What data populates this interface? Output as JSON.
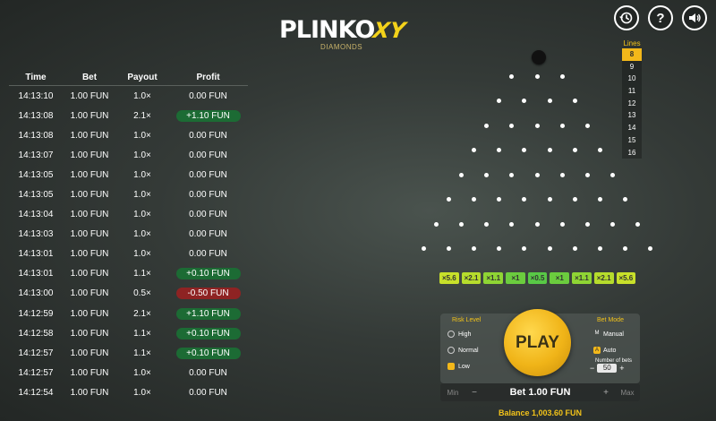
{
  "header": {
    "logo_text": "PLINKO",
    "logo_xy": "XY",
    "logo_sub": "DIAMONDS",
    "icons": [
      "history-icon",
      "help-icon",
      "sound-icon"
    ],
    "help_glyph": "?"
  },
  "history": {
    "columns": [
      "Time",
      "Bet",
      "Payout",
      "Profit"
    ],
    "rows": [
      {
        "time": "14:13:10",
        "bet": "1.00 FUN",
        "payout": "1.0×",
        "profit": "0.00 FUN",
        "type": "none"
      },
      {
        "time": "14:13:08",
        "bet": "1.00 FUN",
        "payout": "2.1×",
        "profit": "+1.10 FUN",
        "type": "win"
      },
      {
        "time": "14:13:08",
        "bet": "1.00 FUN",
        "payout": "1.0×",
        "profit": "0.00 FUN",
        "type": "none"
      },
      {
        "time": "14:13:07",
        "bet": "1.00 FUN",
        "payout": "1.0×",
        "profit": "0.00 FUN",
        "type": "none"
      },
      {
        "time": "14:13:05",
        "bet": "1.00 FUN",
        "payout": "1.0×",
        "profit": "0.00 FUN",
        "type": "none"
      },
      {
        "time": "14:13:05",
        "bet": "1.00 FUN",
        "payout": "1.0×",
        "profit": "0.00 FUN",
        "type": "none"
      },
      {
        "time": "14:13:04",
        "bet": "1.00 FUN",
        "payout": "1.0×",
        "profit": "0.00 FUN",
        "type": "none"
      },
      {
        "time": "14:13:03",
        "bet": "1.00 FUN",
        "payout": "1.0×",
        "profit": "0.00 FUN",
        "type": "none"
      },
      {
        "time": "14:13:01",
        "bet": "1.00 FUN",
        "payout": "1.0×",
        "profit": "0.00 FUN",
        "type": "none"
      },
      {
        "time": "14:13:01",
        "bet": "1.00 FUN",
        "payout": "1.1×",
        "profit": "+0.10 FUN",
        "type": "win"
      },
      {
        "time": "14:13:00",
        "bet": "1.00 FUN",
        "payout": "0.5×",
        "profit": "-0.50 FUN",
        "type": "loss"
      },
      {
        "time": "14:12:59",
        "bet": "1.00 FUN",
        "payout": "2.1×",
        "profit": "+1.10 FUN",
        "type": "win"
      },
      {
        "time": "14:12:58",
        "bet": "1.00 FUN",
        "payout": "1.1×",
        "profit": "+0.10 FUN",
        "type": "win"
      },
      {
        "time": "14:12:57",
        "bet": "1.00 FUN",
        "payout": "1.1×",
        "profit": "+0.10 FUN",
        "type": "win"
      },
      {
        "time": "14:12:57",
        "bet": "1.00 FUN",
        "payout": "1.0×",
        "profit": "0.00 FUN",
        "type": "none"
      },
      {
        "time": "14:12:54",
        "bet": "1.00 FUN",
        "payout": "1.0×",
        "profit": "0.00 FUN",
        "type": "none"
      }
    ]
  },
  "board": {
    "rows": 8,
    "multipliers": [
      "×5.6",
      "×2.1",
      "×1.1",
      "×1",
      "×0.5",
      "×1",
      "×1.1",
      "×2.1",
      "×5.6"
    ],
    "slot_colors": [
      "#c8e02a",
      "#b6dc2c",
      "#8fd534",
      "#6bcc3e",
      "#58c846",
      "#6bcc3e",
      "#8fd534",
      "#b6dc2c",
      "#c8e02a"
    ]
  },
  "lines": {
    "title": "Lines",
    "options": [
      "8",
      "9",
      "10",
      "11",
      "12",
      "13",
      "14",
      "15",
      "16"
    ],
    "selected": "8"
  },
  "risk": {
    "title": "Risk Level",
    "options": [
      "High",
      "Normal",
      "Low"
    ],
    "selected": "Low"
  },
  "play_label": "PLAY",
  "bet_mode": {
    "title": "Bet Mode",
    "manual_label": "Manual",
    "manual_key": "M",
    "auto_label": "Auto",
    "auto_key": "A",
    "selected": "Auto",
    "nob_label": "Number of bets",
    "nob_value": "50",
    "minus": "−",
    "plus": "+"
  },
  "bet": {
    "min_label": "Min",
    "max_label": "Max",
    "minus": "−",
    "plus": "+",
    "value": "Bet 1.00 FUN"
  },
  "balance": "Balance 1,003.60 FUN",
  "colors": {
    "accent": "#f3b81a",
    "win": "#1c6b34",
    "loss": "#8e2323"
  }
}
